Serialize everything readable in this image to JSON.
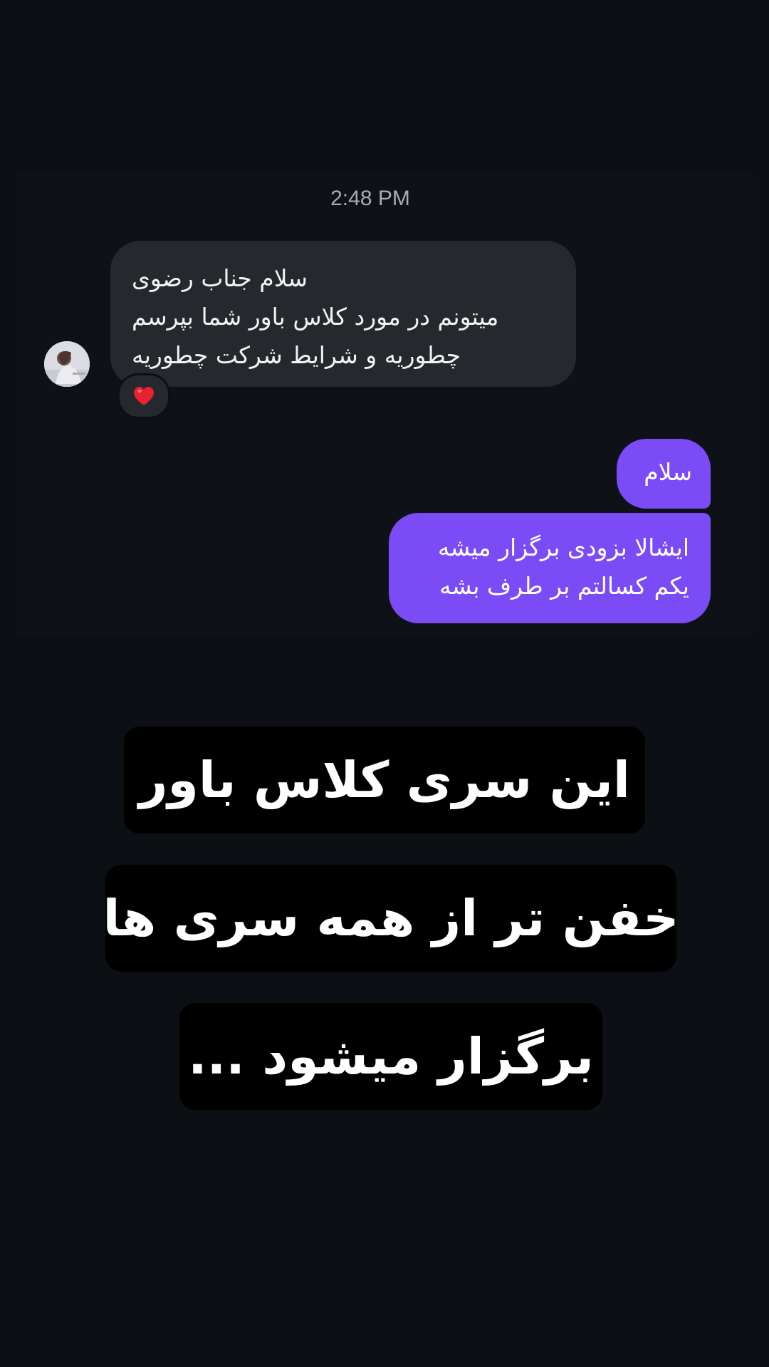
{
  "conversation": {
    "timestamp": "2:48 PM",
    "incoming_message": {
      "lines": [
        "سلام جناب رضوی",
        "میتونم در مورد کلاس باور شما بپرسم",
        "چطوریه و شرایط شرکت چطوریه"
      ],
      "reaction": "❤️"
    },
    "outgoing_messages": [
      {
        "lines": [
          "سلام"
        ]
      },
      {
        "lines": [
          "ایشالا بزودی برگزار میشه",
          "یکم کسالتم بر طرف بشه"
        ]
      }
    ]
  },
  "story_caption": {
    "lines": [
      "این سری کلاس باور",
      "خفن تر از همه سری ها",
      "برگزار میشود ..."
    ]
  },
  "colors": {
    "background": "#0c0f13",
    "incoming_bubble": "#25282d",
    "outgoing_bubble": "#7b4cf6",
    "caption_box": "#000000"
  },
  "icons": {
    "reaction": "heart-icon",
    "avatar": "avatar-photo"
  }
}
